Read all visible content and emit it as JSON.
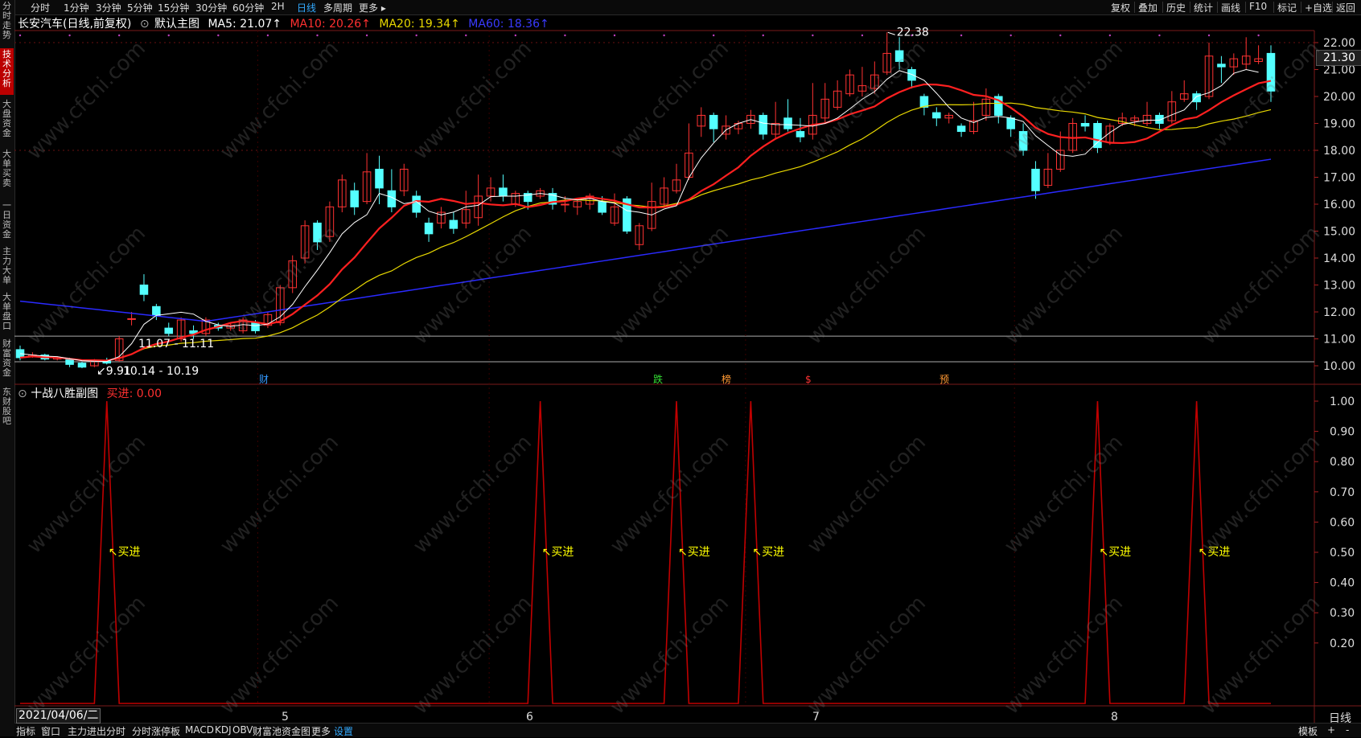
{
  "periods": [
    "分时",
    "1分钟",
    "3分钟",
    "5分钟",
    "15分钟",
    "30分钟",
    "60分钟",
    "2H",
    "日线",
    "多周期",
    "更多"
  ],
  "active_period": "日线",
  "right_tools": [
    "复权",
    "叠加",
    "历史",
    "统计",
    "画线",
    "F10",
    "标记",
    "+自选",
    "返回"
  ],
  "left_tabs": [
    {
      "label": "分时走势",
      "active": false
    },
    {
      "label": "技术分析",
      "active": true
    },
    {
      "label": "大盘资金",
      "active": false
    },
    {
      "label": "大单买卖",
      "active": false
    },
    {
      "label": "一日资金",
      "active": false
    },
    {
      "label": "主力大单",
      "active": false
    },
    {
      "label": "大单盘口",
      "active": false
    },
    {
      "label": "财富资金",
      "active": false
    },
    {
      "label": "东财股吧",
      "active": false
    }
  ],
  "stock": {
    "name": "长安汽车(日线,前复权)",
    "main_chart": "默认主图",
    "ma5": "MA5: 21.07↑",
    "ma10": "MA10: 20.26↑",
    "ma20": "MA20: 19.34↑",
    "ma60": "MA60: 18.36↑"
  },
  "colors": {
    "ma5": "#ffffff",
    "ma10": "#ff2020",
    "ma20": "#e8d800",
    "ma60": "#2a2aff",
    "up": "#ff3232",
    "down": "#54ffff",
    "signal": "#c00000",
    "buy_label": "#ffff00"
  },
  "price_axis": [
    "22.00",
    "21.00",
    "20.00",
    "19.00",
    "18.00",
    "17.00",
    "16.00",
    "15.00",
    "14.00",
    "13.00",
    "12.00",
    "11.00",
    "10.00"
  ],
  "current_price": "21.30",
  "high_label": "22.38",
  "low_label": "9.91",
  "range_labels": [
    "11.07 - 11.11",
    "10.14 - 10.19"
  ],
  "event_markers": [
    {
      "label": "财",
      "color": "#3399ff"
    },
    {
      "label": "跌",
      "color": "#33dd33"
    },
    {
      "label": "榜",
      "color": "#ff9933"
    },
    {
      "label": "$",
      "color": "#ff3333"
    },
    {
      "label": "预",
      "color": "#ff9933"
    }
  ],
  "sub_chart": {
    "title": "十战八胜副图",
    "buy_value": "买进: 0.00",
    "axis": [
      "1.00",
      "0.90",
      "0.80",
      "0.70",
      "0.60",
      "0.50",
      "0.40",
      "0.30",
      "0.20"
    ],
    "buy_text": "买进"
  },
  "x_axis": {
    "date": "2021/04/06/二",
    "months": [
      "5",
      "6",
      "7",
      "8"
    ]
  },
  "bottom_tabs": [
    "指标",
    "窗口",
    "主力进出分时",
    "分时涨停板",
    "MACD",
    "KDJ",
    "OBV",
    "财富池资金图",
    "更多",
    "设置"
  ],
  "bottom_right": [
    "模板",
    "+",
    "-"
  ],
  "period_label_right": "日线",
  "watermark": "www.cfchi.com",
  "chart_data": {
    "type": "candlestick",
    "candles": [
      [
        10.6,
        10.3,
        10.75,
        10.2
      ],
      [
        10.35,
        10.4,
        10.5,
        10.3
      ],
      [
        10.4,
        10.25,
        10.45,
        10.2
      ],
      [
        10.25,
        10.3,
        10.35,
        10.2
      ],
      [
        10.25,
        10.05,
        10.3,
        9.95
      ],
      [
        10.1,
        9.95,
        10.15,
        9.91
      ],
      [
        10.0,
        10.2,
        10.25,
        9.95
      ],
      [
        10.2,
        10.1,
        10.3,
        10.05
      ],
      [
        10.2,
        11.0,
        11.1,
        10.15
      ],
      [
        11.75,
        11.75,
        12.0,
        11.5
      ],
      [
        13.0,
        12.65,
        13.4,
        12.4
      ],
      [
        12.2,
        11.85,
        12.3,
        11.7
      ],
      [
        11.4,
        11.2,
        11.6,
        11.1
      ],
      [
        11.0,
        11.7,
        11.8,
        10.9
      ],
      [
        11.3,
        11.2,
        11.5,
        11.0
      ],
      [
        11.2,
        11.7,
        11.8,
        11.1
      ],
      [
        11.5,
        11.4,
        11.6,
        11.3
      ],
      [
        11.4,
        11.5,
        11.6,
        11.3
      ],
      [
        11.3,
        11.7,
        11.8,
        11.2
      ],
      [
        11.6,
        11.3,
        11.7,
        11.2
      ],
      [
        11.5,
        11.9,
        12.0,
        11.4
      ],
      [
        11.6,
        12.9,
        13.0,
        11.5
      ],
      [
        12.9,
        13.9,
        14.1,
        12.7
      ],
      [
        14.0,
        15.2,
        15.4,
        13.8
      ],
      [
        15.3,
        14.6,
        15.4,
        14.3
      ],
      [
        14.8,
        15.9,
        16.1,
        14.6
      ],
      [
        15.9,
        16.9,
        17.1,
        15.7
      ],
      [
        16.5,
        15.9,
        16.8,
        15.6
      ],
      [
        16.1,
        17.2,
        17.9,
        16.0
      ],
      [
        17.3,
        16.6,
        17.8,
        16.0
      ],
      [
        16.5,
        15.9,
        17.3,
        15.7
      ],
      [
        16.5,
        17.3,
        17.5,
        16.3
      ],
      [
        16.3,
        15.7,
        16.5,
        15.5
      ],
      [
        15.3,
        14.9,
        15.5,
        14.6
      ],
      [
        15.3,
        15.7,
        15.9,
        15.1
      ],
      [
        15.4,
        15.1,
        15.7,
        14.9
      ],
      [
        15.3,
        15.8,
        16.5,
        15.1
      ],
      [
        15.5,
        16.3,
        17.1,
        15.2
      ],
      [
        16.3,
        16.6,
        17.0,
        16.1
      ],
      [
        16.6,
        16.3,
        17.1,
        16.1
      ],
      [
        16.0,
        16.4,
        16.5,
        15.9
      ],
      [
        16.4,
        16.1,
        16.5,
        15.8
      ],
      [
        16.3,
        16.5,
        16.6,
        16.2
      ],
      [
        16.4,
        16.0,
        16.6,
        15.8
      ],
      [
        16.0,
        16.0,
        16.3,
        15.7
      ],
      [
        15.9,
        16.1,
        16.2,
        15.6
      ],
      [
        16.0,
        16.3,
        16.4,
        15.8
      ],
      [
        16.1,
        15.7,
        16.3,
        15.6
      ],
      [
        15.3,
        15.9,
        16.4,
        15.2
      ],
      [
        16.2,
        15.0,
        16.3,
        14.9
      ],
      [
        14.5,
        15.2,
        15.3,
        14.3
      ],
      [
        15.1,
        16.1,
        16.8,
        15.0
      ],
      [
        16.0,
        16.6,
        17.0,
        15.9
      ],
      [
        16.5,
        16.9,
        17.5,
        16.4
      ],
      [
        17.0,
        17.9,
        19.0,
        16.9
      ],
      [
        18.9,
        19.3,
        19.6,
        18.5
      ],
      [
        19.3,
        18.8,
        19.4,
        18.3
      ],
      [
        18.6,
        18.9,
        19.3,
        18.4
      ],
      [
        18.8,
        19.0,
        19.1,
        18.6
      ],
      [
        19.0,
        19.3,
        19.5,
        18.8
      ],
      [
        19.3,
        18.6,
        19.4,
        18.4
      ],
      [
        18.6,
        19.0,
        19.8,
        18.4
      ],
      [
        19.2,
        18.8,
        19.9,
        18.7
      ],
      [
        18.7,
        18.5,
        19.2,
        18.3
      ],
      [
        18.6,
        19.3,
        20.5,
        18.4
      ],
      [
        19.2,
        19.9,
        20.5,
        19.0
      ],
      [
        19.6,
        20.2,
        20.6,
        19.5
      ],
      [
        20.1,
        20.8,
        21.0,
        20.0
      ],
      [
        20.2,
        20.4,
        21.1,
        20.0
      ],
      [
        20.3,
        20.8,
        21.3,
        20.1
      ],
      [
        20.9,
        21.6,
        22.38,
        20.8
      ],
      [
        21.7,
        21.3,
        22.2,
        21.0
      ],
      [
        21.0,
        20.6,
        21.1,
        20.3
      ],
      [
        20.0,
        19.6,
        20.1,
        19.3
      ],
      [
        19.4,
        19.2,
        19.6,
        18.9
      ],
      [
        19.2,
        19.3,
        19.4,
        19.0
      ],
      [
        18.9,
        18.7,
        19.0,
        18.5
      ],
      [
        18.7,
        19.1,
        19.8,
        18.6
      ],
      [
        19.3,
        19.9,
        20.3,
        19.1
      ],
      [
        20.0,
        19.3,
        20.1,
        19.0
      ],
      [
        19.2,
        18.8,
        19.3,
        18.5
      ],
      [
        18.7,
        18.0,
        19.0,
        17.8
      ],
      [
        17.3,
        16.5,
        17.6,
        16.2
      ],
      [
        16.7,
        17.3,
        17.9,
        16.6
      ],
      [
        17.3,
        18.0,
        18.7,
        17.2
      ],
      [
        18.0,
        19.0,
        19.2,
        17.9
      ],
      [
        19.0,
        18.9,
        19.3,
        18.7
      ],
      [
        19.0,
        18.1,
        19.1,
        17.9
      ],
      [
        18.3,
        18.9,
        19.0,
        18.2
      ],
      [
        19.0,
        19.2,
        19.4,
        18.9
      ],
      [
        19.1,
        19.2,
        19.3,
        18.9
      ],
      [
        19.0,
        19.3,
        19.8,
        18.9
      ],
      [
        19.3,
        19.0,
        19.4,
        18.8
      ],
      [
        19.1,
        19.8,
        20.2,
        19.0
      ],
      [
        19.9,
        20.1,
        20.6,
        19.8
      ],
      [
        20.1,
        19.8,
        20.2,
        19.5
      ],
      [
        20.0,
        21.5,
        22.0,
        19.9
      ],
      [
        21.2,
        21.1,
        21.5,
        20.5
      ],
      [
        21.1,
        21.4,
        21.6,
        20.8
      ],
      [
        21.2,
        21.5,
        22.2,
        21.0
      ],
      [
        21.3,
        21.4,
        21.9,
        21.2
      ],
      [
        21.6,
        20.2,
        21.9,
        19.8
      ]
    ],
    "ma5": [
      10.45,
      10.4,
      10.36,
      10.34,
      10.26,
      10.19,
      10.17,
      10.16,
      10.34,
      10.82,
      11.54,
      11.87,
      11.93,
      11.99,
      11.92,
      11.65,
      11.52,
      11.46,
      11.53,
      11.49,
      11.55,
      11.82,
      12.28,
      12.94,
      13.55,
      14.2,
      14.9,
      15.32,
      15.61,
      16.4,
      16.26,
      16.02,
      16.1,
      15.74,
      15.6,
      15.71,
      15.9,
      15.96,
      16.28,
      16.3,
      16.3,
      16.34,
      16.4,
      16.34,
      16.22,
      16.16,
      16.22,
      16.1,
      16.04,
      15.76,
      15.7,
      15.6,
      15.82,
      15.94,
      16.98,
      17.72,
      18.27,
      18.76,
      19.0,
      19.14,
      19.01,
      18.96,
      18.95,
      18.93,
      18.9,
      19.0,
      19.2,
      19.54,
      19.9,
      20.18,
      20.64,
      20.96,
      20.82,
      20.6,
      20.12,
      19.6,
      19.2,
      19.03,
      19.22,
      19.26,
      19.2,
      19.07,
      18.54,
      18.18,
      17.83,
      17.78,
      17.86,
      18.3,
      18.66,
      18.96,
      19.05,
      19.12,
      19.12,
      19.32,
      19.5,
      20.0,
      20.14,
      20.4,
      20.86,
      21.0,
      20.9
    ]
  }
}
